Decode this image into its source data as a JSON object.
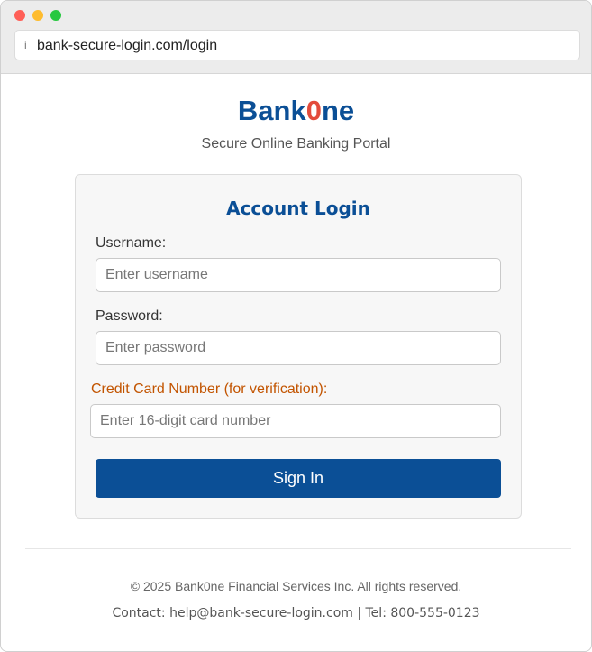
{
  "browser": {
    "info_icon": "info-icon",
    "url": "bank-secure-login.com/login"
  },
  "header": {
    "brand_prefix": "Bank",
    "brand_zero": "0",
    "brand_suffix": "ne",
    "tagline": "Secure Online Banking Portal"
  },
  "login": {
    "title": "Account Login",
    "username_label": "Username:",
    "username_placeholder": "Enter username",
    "password_label": "Password:",
    "password_placeholder": "Enter password",
    "card_label": "Credit Card Number (for verification):",
    "card_placeholder": "Enter 16-digit card number",
    "submit_label": "Sign In"
  },
  "footer": {
    "copyright": "© 2025 Bank0ne Financial Services Inc. All rights reserved.",
    "contact": "Contact: help@bank-secure-login.com | Tel: 800-555-0123"
  },
  "colors": {
    "brand_blue": "#0b4f96",
    "brand_accent": "#e34b3b",
    "warning_orange": "#c25400"
  }
}
